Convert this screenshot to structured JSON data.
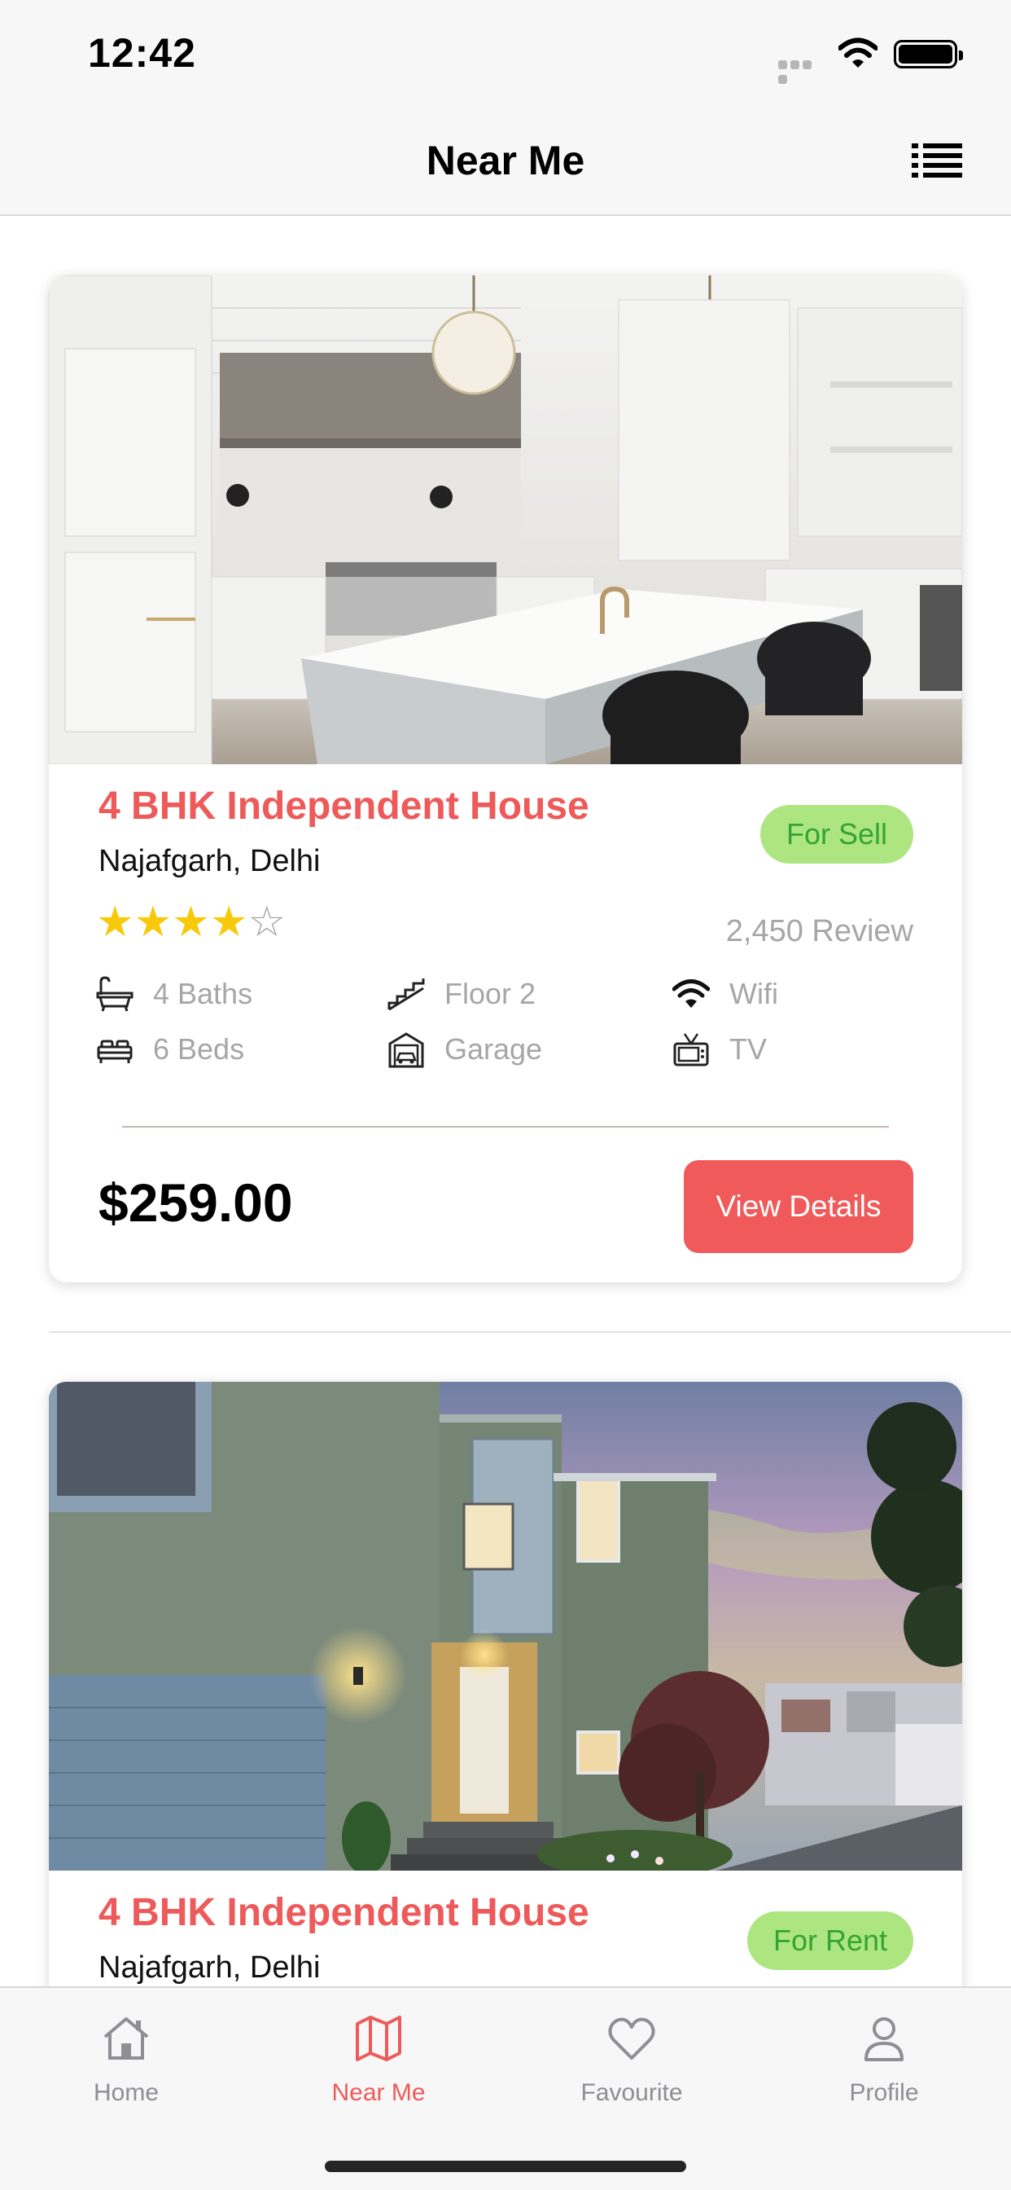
{
  "status_bar": {
    "time": "12:42"
  },
  "nav": {
    "title": "Near Me",
    "list_icon": "list-icon"
  },
  "listings": [
    {
      "title": "4 BHK Independent House",
      "location": "Najafgarh, Delhi",
      "badge": "For Sell",
      "rating": 4,
      "rating_max": 5,
      "reviews": "2,450 Review",
      "amenities": {
        "baths": "4 Baths",
        "floor": "Floor 2",
        "wifi": "Wifi",
        "beds": "6 Beds",
        "garage": "Garage",
        "tv": "TV"
      },
      "price": "$259.00",
      "button": "View Details"
    },
    {
      "title": "4 BHK Independent House",
      "location": "Najafgarh, Delhi",
      "badge": "For Rent"
    }
  ],
  "tabs": [
    {
      "label": "Home",
      "icon": "home-icon"
    },
    {
      "label": "Near Me",
      "icon": "map-icon",
      "active": true
    },
    {
      "label": "Favourite",
      "icon": "heart-icon"
    },
    {
      "label": "Profile",
      "icon": "person-icon"
    }
  ],
  "colors": {
    "accent": "#ee5a5a",
    "badge_bg": "#ade680",
    "badge_text": "#35a335",
    "star": "#f8c90a",
    "muted_text": "#a6a6a6"
  }
}
